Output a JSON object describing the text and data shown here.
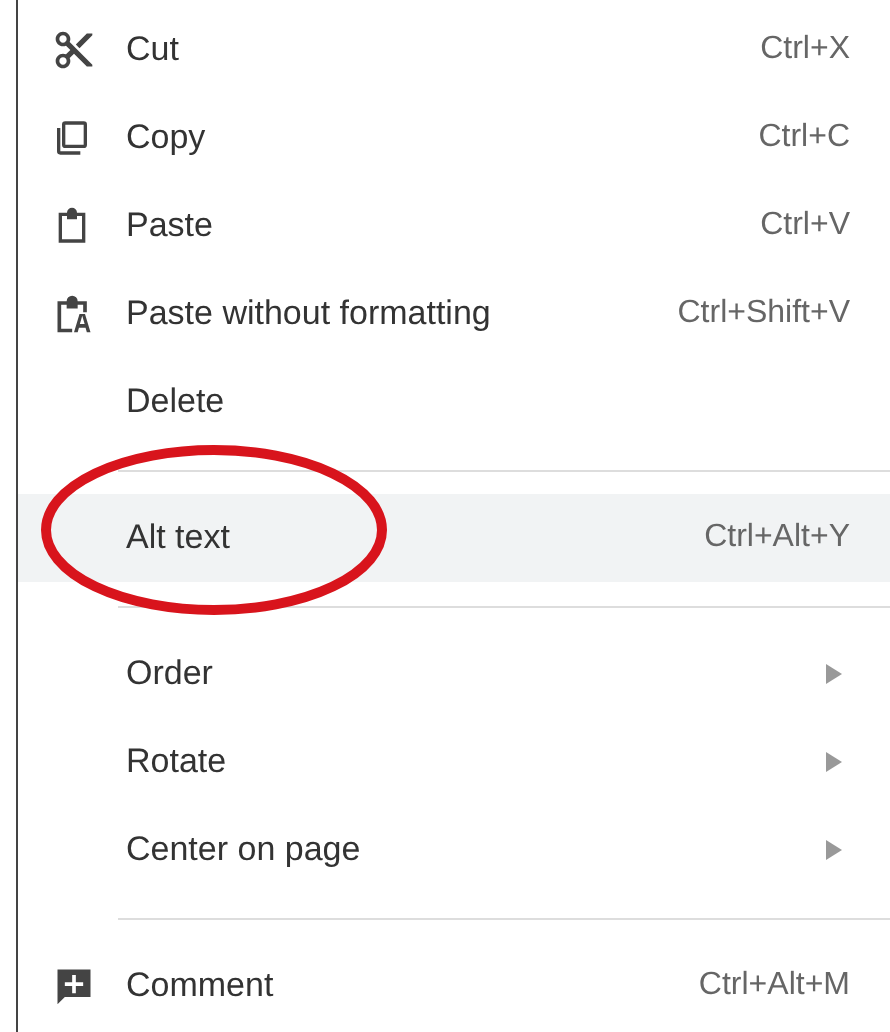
{
  "menu": {
    "items": [
      {
        "kind": "action",
        "label": "Cut",
        "shortcut": "Ctrl+X",
        "selected": false,
        "submenu": false
      },
      {
        "kind": "action",
        "label": "Copy",
        "shortcut": "Ctrl+C",
        "selected": false,
        "submenu": false
      },
      {
        "kind": "action",
        "label": "Paste",
        "shortcut": "Ctrl+V",
        "selected": false,
        "submenu": false
      },
      {
        "kind": "action",
        "label": "Paste without formatting",
        "shortcut": "Ctrl+Shift+V",
        "selected": false,
        "submenu": false
      },
      {
        "kind": "action",
        "label": "Delete",
        "selected": false,
        "submenu": false
      },
      {
        "kind": "separator"
      },
      {
        "kind": "action",
        "label": "Alt text",
        "shortcut": "Ctrl+Alt+Y",
        "selected": true,
        "submenu": false,
        "circled": true
      },
      {
        "kind": "separator"
      },
      {
        "kind": "action",
        "label": "Order",
        "selected": false,
        "submenu": true
      },
      {
        "kind": "action",
        "label": "Rotate",
        "selected": false,
        "submenu": true
      },
      {
        "kind": "action",
        "label": "Center on page",
        "selected": false,
        "submenu": true
      },
      {
        "kind": "separator"
      },
      {
        "kind": "action",
        "label": "Comment",
        "shortcut": "Ctrl+Alt+M",
        "selected": false,
        "submenu": false
      }
    ]
  }
}
